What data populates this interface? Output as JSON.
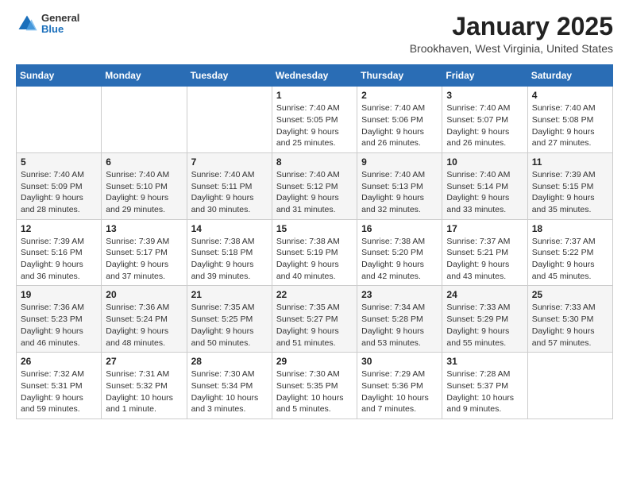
{
  "logo": {
    "general": "General",
    "blue": "Blue"
  },
  "header": {
    "title": "January 2025",
    "subtitle": "Brookhaven, West Virginia, United States"
  },
  "weekdays": [
    "Sunday",
    "Monday",
    "Tuesday",
    "Wednesday",
    "Thursday",
    "Friday",
    "Saturday"
  ],
  "weeks": [
    [
      {
        "day": "",
        "info": ""
      },
      {
        "day": "",
        "info": ""
      },
      {
        "day": "",
        "info": ""
      },
      {
        "day": "1",
        "info": "Sunrise: 7:40 AM\nSunset: 5:05 PM\nDaylight: 9 hours\nand 25 minutes."
      },
      {
        "day": "2",
        "info": "Sunrise: 7:40 AM\nSunset: 5:06 PM\nDaylight: 9 hours\nand 26 minutes."
      },
      {
        "day": "3",
        "info": "Sunrise: 7:40 AM\nSunset: 5:07 PM\nDaylight: 9 hours\nand 26 minutes."
      },
      {
        "day": "4",
        "info": "Sunrise: 7:40 AM\nSunset: 5:08 PM\nDaylight: 9 hours\nand 27 minutes."
      }
    ],
    [
      {
        "day": "5",
        "info": "Sunrise: 7:40 AM\nSunset: 5:09 PM\nDaylight: 9 hours\nand 28 minutes."
      },
      {
        "day": "6",
        "info": "Sunrise: 7:40 AM\nSunset: 5:10 PM\nDaylight: 9 hours\nand 29 minutes."
      },
      {
        "day": "7",
        "info": "Sunrise: 7:40 AM\nSunset: 5:11 PM\nDaylight: 9 hours\nand 30 minutes."
      },
      {
        "day": "8",
        "info": "Sunrise: 7:40 AM\nSunset: 5:12 PM\nDaylight: 9 hours\nand 31 minutes."
      },
      {
        "day": "9",
        "info": "Sunrise: 7:40 AM\nSunset: 5:13 PM\nDaylight: 9 hours\nand 32 minutes."
      },
      {
        "day": "10",
        "info": "Sunrise: 7:40 AM\nSunset: 5:14 PM\nDaylight: 9 hours\nand 33 minutes."
      },
      {
        "day": "11",
        "info": "Sunrise: 7:39 AM\nSunset: 5:15 PM\nDaylight: 9 hours\nand 35 minutes."
      }
    ],
    [
      {
        "day": "12",
        "info": "Sunrise: 7:39 AM\nSunset: 5:16 PM\nDaylight: 9 hours\nand 36 minutes."
      },
      {
        "day": "13",
        "info": "Sunrise: 7:39 AM\nSunset: 5:17 PM\nDaylight: 9 hours\nand 37 minutes."
      },
      {
        "day": "14",
        "info": "Sunrise: 7:38 AM\nSunset: 5:18 PM\nDaylight: 9 hours\nand 39 minutes."
      },
      {
        "day": "15",
        "info": "Sunrise: 7:38 AM\nSunset: 5:19 PM\nDaylight: 9 hours\nand 40 minutes."
      },
      {
        "day": "16",
        "info": "Sunrise: 7:38 AM\nSunset: 5:20 PM\nDaylight: 9 hours\nand 42 minutes."
      },
      {
        "day": "17",
        "info": "Sunrise: 7:37 AM\nSunset: 5:21 PM\nDaylight: 9 hours\nand 43 minutes."
      },
      {
        "day": "18",
        "info": "Sunrise: 7:37 AM\nSunset: 5:22 PM\nDaylight: 9 hours\nand 45 minutes."
      }
    ],
    [
      {
        "day": "19",
        "info": "Sunrise: 7:36 AM\nSunset: 5:23 PM\nDaylight: 9 hours\nand 46 minutes."
      },
      {
        "day": "20",
        "info": "Sunrise: 7:36 AM\nSunset: 5:24 PM\nDaylight: 9 hours\nand 48 minutes."
      },
      {
        "day": "21",
        "info": "Sunrise: 7:35 AM\nSunset: 5:25 PM\nDaylight: 9 hours\nand 50 minutes."
      },
      {
        "day": "22",
        "info": "Sunrise: 7:35 AM\nSunset: 5:27 PM\nDaylight: 9 hours\nand 51 minutes."
      },
      {
        "day": "23",
        "info": "Sunrise: 7:34 AM\nSunset: 5:28 PM\nDaylight: 9 hours\nand 53 minutes."
      },
      {
        "day": "24",
        "info": "Sunrise: 7:33 AM\nSunset: 5:29 PM\nDaylight: 9 hours\nand 55 minutes."
      },
      {
        "day": "25",
        "info": "Sunrise: 7:33 AM\nSunset: 5:30 PM\nDaylight: 9 hours\nand 57 minutes."
      }
    ],
    [
      {
        "day": "26",
        "info": "Sunrise: 7:32 AM\nSunset: 5:31 PM\nDaylight: 9 hours\nand 59 minutes."
      },
      {
        "day": "27",
        "info": "Sunrise: 7:31 AM\nSunset: 5:32 PM\nDaylight: 10 hours\nand 1 minute."
      },
      {
        "day": "28",
        "info": "Sunrise: 7:30 AM\nSunset: 5:34 PM\nDaylight: 10 hours\nand 3 minutes."
      },
      {
        "day": "29",
        "info": "Sunrise: 7:30 AM\nSunset: 5:35 PM\nDaylight: 10 hours\nand 5 minutes."
      },
      {
        "day": "30",
        "info": "Sunrise: 7:29 AM\nSunset: 5:36 PM\nDaylight: 10 hours\nand 7 minutes."
      },
      {
        "day": "31",
        "info": "Sunrise: 7:28 AM\nSunset: 5:37 PM\nDaylight: 10 hours\nand 9 minutes."
      },
      {
        "day": "",
        "info": ""
      }
    ]
  ]
}
